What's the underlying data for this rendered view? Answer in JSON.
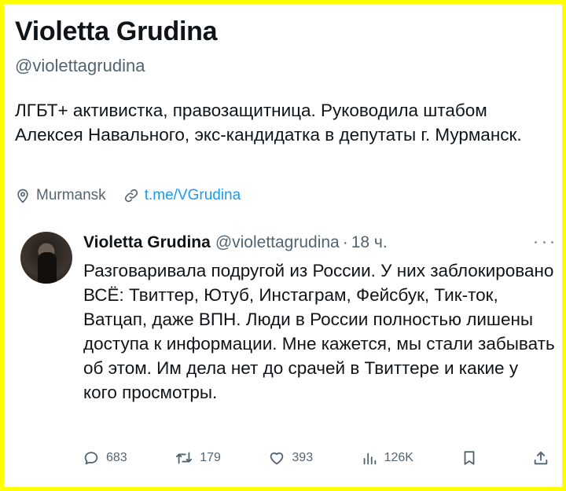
{
  "profile": {
    "name": "Violetta Grudina",
    "handle": "@violettagrudina",
    "bio": "ЛГБТ+ активистка, правозащитница. Руководила штабом Алексея Навального, экс-кандидатка в депутаты г. Мурманск.",
    "location": "Murmansk",
    "link": "t.me/VGrudina"
  },
  "tweet": {
    "author": "Violetta Grudina",
    "handle": "@violettagrudina",
    "separator": "·",
    "time": "18 ч.",
    "text": "Разговаривала подругой из России. У них заблокировано ВСЁ: Твиттер, Ютуб, Инстаграм, Фейсбук, Тик-ток, Ватцап, даже ВПН. Люди в России полностью лишены доступа к информации. Мне кажется, мы стали забывать об этом. Им дела нет до срачей в Твиттере и какие у кого просмотры.",
    "stats": {
      "replies": "683",
      "retweets": "179",
      "likes": "393",
      "views": "126K"
    }
  },
  "colors": {
    "frame": "#ffff00",
    "text": "#0f1419",
    "secondary": "#536471",
    "link": "#1d9bf0"
  },
  "icons": [
    "location-icon",
    "link-icon",
    "more-icon",
    "reply-icon",
    "retweet-icon",
    "like-icon",
    "views-icon",
    "bookmark-icon",
    "share-icon"
  ]
}
